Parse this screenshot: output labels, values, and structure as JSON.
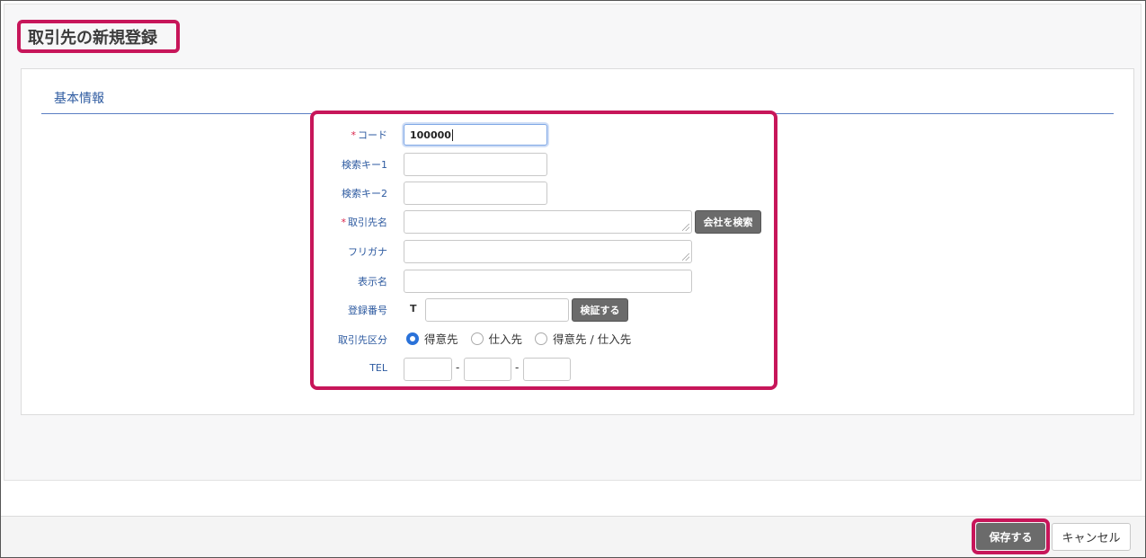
{
  "page": {
    "title": "取引先の新規登録"
  },
  "section": {
    "title": "基本情報"
  },
  "form": {
    "code": {
      "label": "コード",
      "required": "*",
      "value": "100000"
    },
    "search_key1": {
      "label": "検索キー1",
      "value": ""
    },
    "search_key2": {
      "label": "検索キー2",
      "value": ""
    },
    "partner_name": {
      "label": "取引先名",
      "required": "*",
      "value": "",
      "search_button": "会社を検索"
    },
    "furigana": {
      "label": "フリガナ",
      "value": ""
    },
    "display_name": {
      "label": "表示名",
      "value": ""
    },
    "registration_number": {
      "label": "登録番号",
      "prefix": "T",
      "value": "",
      "verify_button": "検証する"
    },
    "partner_type": {
      "label": "取引先区分",
      "options": [
        "得意先",
        "仕入先",
        "得意先 / 仕入先"
      ],
      "selected": "得意先"
    },
    "tel": {
      "label": "TEL",
      "part1": "",
      "part2": "",
      "part3": "",
      "separator": "-"
    }
  },
  "footer": {
    "save_label": "保存する",
    "cancel_label": "キャンセル"
  },
  "colors": {
    "highlight": "#c7165a",
    "accent": "#2d5aa0",
    "button_gray": "#6b6b6b",
    "radio_checked": "#2a72d9"
  }
}
